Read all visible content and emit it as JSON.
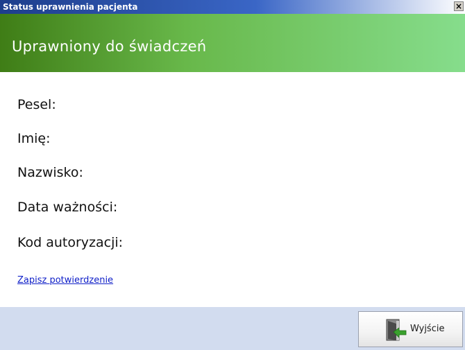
{
  "window": {
    "title": "Status uprawnienia pacjenta",
    "close_label": "×"
  },
  "banner": {
    "status": "Uprawniony do świadczeń"
  },
  "fields": {
    "pesel": "Pesel:",
    "imie": "Imię:",
    "nazwisko": "Nazwisko:",
    "data_waznosci": "Data ważności:",
    "kod_autoryzacji": "Kod autoryzacji:"
  },
  "actions": {
    "save_link": "Zapisz potwierdzenie",
    "exit_label": "Wyjście"
  },
  "icons": {
    "close": "close-icon",
    "exit": "exit-door-icon"
  },
  "colors": {
    "titlebar": "#1d3e8c",
    "banner_start": "#3f7d16",
    "banner_end": "#86dd8c",
    "footer": "#d2dcef",
    "link": "#1020c8"
  }
}
